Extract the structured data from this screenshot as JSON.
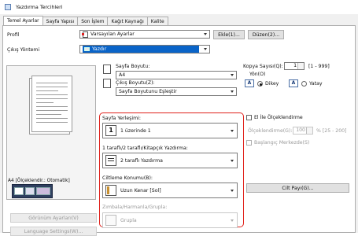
{
  "window": {
    "title": "Yazdırma Tercihleri"
  },
  "tabs": [
    {
      "label": "Temel Ayarlar"
    },
    {
      "label": "Sayfa Yapısı"
    },
    {
      "label": "Son İşlem"
    },
    {
      "label": "Kağıt Kaynağı"
    },
    {
      "label": "Kalite"
    }
  ],
  "profile": {
    "label": "Profil",
    "value": "Varsayılan Ayarlar",
    "add_button": "Ekle(1)...",
    "edit_button": "Düzen(2)..."
  },
  "output": {
    "label": "Çıkış Yöntemi",
    "value": "Yazdır"
  },
  "preview": {
    "caption": "A4 [Ölçeklendir.: Otomatik]",
    "view_settings_button": "Görünüm Ayarları(V)",
    "language_button": "Language Settings(W)..."
  },
  "page_size": {
    "label": "Sayfa Boyutu:",
    "value": "A4"
  },
  "output_size": {
    "label": "Çıkış Boyutu(Z):",
    "value": "Sayfa Boyutunu Eşleştir"
  },
  "copies": {
    "label": "Kopya Sayısı(Q):",
    "value": "1",
    "range": "[1 - 999]"
  },
  "orientation": {
    "label": "Yön(O)",
    "portrait": "Dikey",
    "landscape": "Yatay",
    "icon_letter": "A"
  },
  "layout": {
    "label": "Sayfa Yerleşimi:",
    "value": "1 üzerinde 1",
    "icon_number": "1"
  },
  "duplex": {
    "label": "1 taraflı/2 taraflı/Kitapçık Yazdırma:",
    "value": "2 taraflı Yazdırma"
  },
  "binding": {
    "label": "Ciltleme Konumu(B):",
    "value": "Uzun Kenar [Sol]",
    "gutter_button": "Cilt Payı(G)..."
  },
  "scaling": {
    "checkbox_label": "El İle Ölçeklendirme",
    "scale_label": "Ölçeklendirme(G):",
    "scale_value": "100",
    "scale_range": "% [25 - 200]",
    "base_point_label": "Başlangıç Merkezde(S)"
  },
  "staple": {
    "label": "Zımbala/Harmanla/Grupla:",
    "value": "Grupla"
  }
}
